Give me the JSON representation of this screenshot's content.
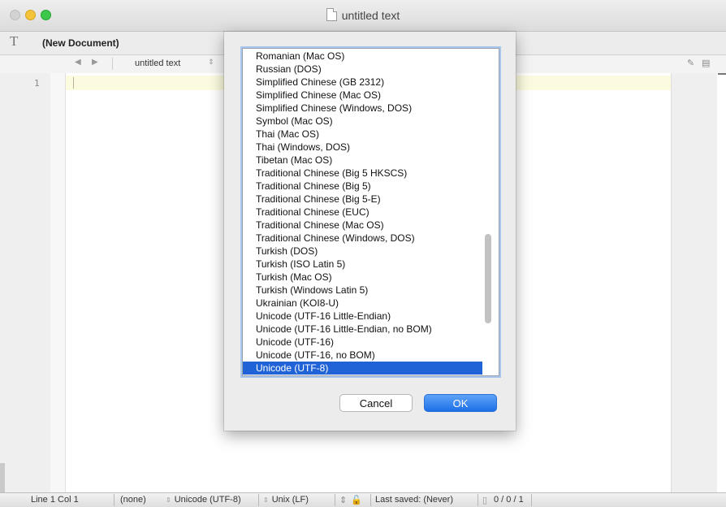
{
  "window": {
    "title": "untitled text"
  },
  "toolbar": {
    "document_label": "(New Document)"
  },
  "navbar": {
    "file_name": "untitled text"
  },
  "editor": {
    "line_number": "1"
  },
  "statusbar": {
    "position": "Line 1 Col 1",
    "language": "(none)",
    "encoding": "Unicode (UTF-8)",
    "line_endings": "Unix (LF)",
    "last_saved": "Last saved: (Never)",
    "counts": "0 / 0 / 1"
  },
  "dialog": {
    "encodings": [
      "Romanian (Mac OS)",
      "Russian (DOS)",
      "Simplified Chinese (GB 2312)",
      "Simplified Chinese (Mac OS)",
      "Simplified Chinese (Windows, DOS)",
      "Symbol (Mac OS)",
      "Thai (Mac OS)",
      "Thai (Windows, DOS)",
      "Tibetan (Mac OS)",
      "Traditional Chinese (Big 5 HKSCS)",
      "Traditional Chinese (Big 5)",
      "Traditional Chinese (Big 5-E)",
      "Traditional Chinese (EUC)",
      "Traditional Chinese (Mac OS)",
      "Traditional Chinese (Windows, DOS)",
      "Turkish (DOS)",
      "Turkish (ISO Latin 5)",
      "Turkish (Mac OS)",
      "Turkish (Windows Latin 5)",
      "Ukrainian (KOI8-U)",
      "Unicode (UTF-16 Little-Endian)",
      "Unicode (UTF-16 Little-Endian, no BOM)",
      "Unicode (UTF-16)",
      "Unicode (UTF-16, no BOM)",
      "Unicode (UTF-8)"
    ],
    "selected": "Unicode (UTF-8)",
    "cancel_label": "Cancel",
    "ok_label": "OK"
  },
  "colors": {
    "selection": "#1f63d6",
    "ok_button": "#1d6fe7",
    "current_line": "#fcfbdf"
  }
}
